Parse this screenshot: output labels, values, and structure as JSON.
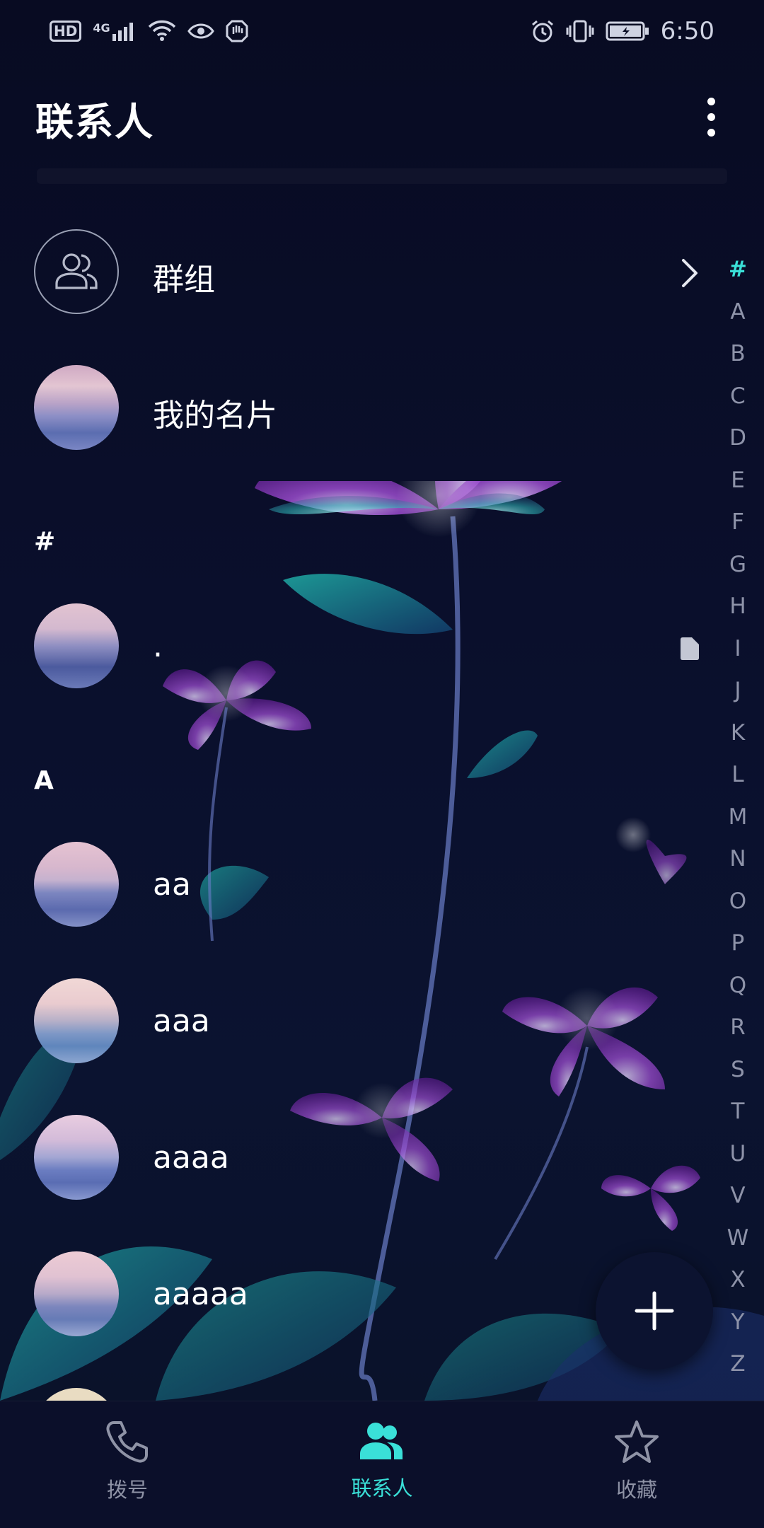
{
  "status_bar": {
    "time": "6:50",
    "left_badges": [
      "HD",
      "4G"
    ],
    "icons": [
      "hd-icon",
      "signal-icon",
      "wifi-icon",
      "eye-icon",
      "hand-icon",
      "alarm-icon",
      "vibrate-icon",
      "battery-icon"
    ]
  },
  "header": {
    "title": "联系人"
  },
  "special_rows": {
    "groups_label": "群组",
    "my_card_label": "我的名片"
  },
  "sections": [
    {
      "header": "#",
      "contacts": [
        {
          "name": "."
        }
      ]
    },
    {
      "header": "A",
      "contacts": [
        {
          "name": "aa"
        },
        {
          "name": "aaa"
        },
        {
          "name": "aaaa"
        },
        {
          "name": "aaaaa"
        }
      ]
    }
  ],
  "index_letters": [
    "#",
    "A",
    "B",
    "C",
    "D",
    "E",
    "F",
    "G",
    "H",
    "I",
    "J",
    "K",
    "L",
    "M",
    "N",
    "O",
    "P",
    "Q",
    "R",
    "S",
    "T",
    "U",
    "V",
    "W",
    "X",
    "Y",
    "Z"
  ],
  "bottom_nav": {
    "dial": "拨号",
    "contacts": "联系人",
    "favorites": "收藏"
  },
  "colors": {
    "accent": "#3ae0d8",
    "background": "#0a0d24",
    "inactive": "#8f93a6"
  }
}
